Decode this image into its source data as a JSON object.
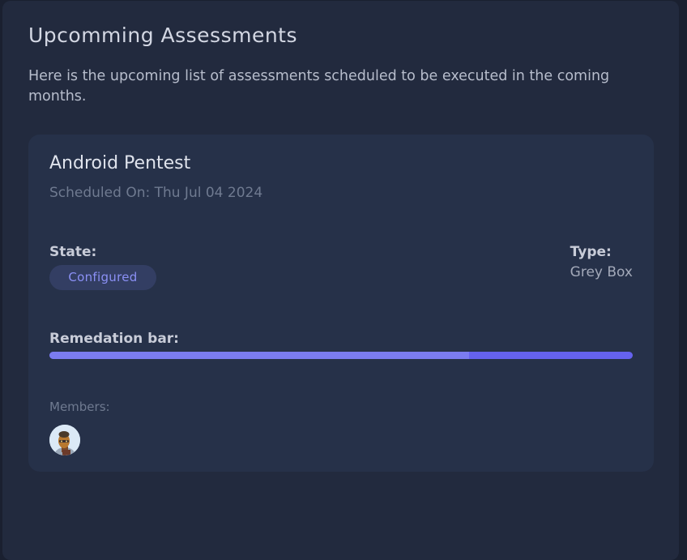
{
  "panel": {
    "title": "Upcomming Assessments",
    "description": "Here is the upcoming list of assessments scheduled to be executed in the coming months."
  },
  "assessment": {
    "name": "Android Pentest",
    "scheduled_on": "Scheduled On: Thu Jul 04 2024",
    "state_label": "State:",
    "state_value": "Configured",
    "type_label": "Type:",
    "type_value": "Grey Box",
    "remediation_label": "Remedation bar:",
    "remediation_progress": 0.72,
    "members_label": "Members:",
    "members": [
      {
        "avatar_icon": "user-avatar-icon"
      }
    ]
  },
  "colors": {
    "background": "#1a2030",
    "panel": "#222a3e",
    "card": "#263149",
    "accent": "#6562ee",
    "badge_bg": "#333e63",
    "badge_text": "#8b90f5"
  }
}
